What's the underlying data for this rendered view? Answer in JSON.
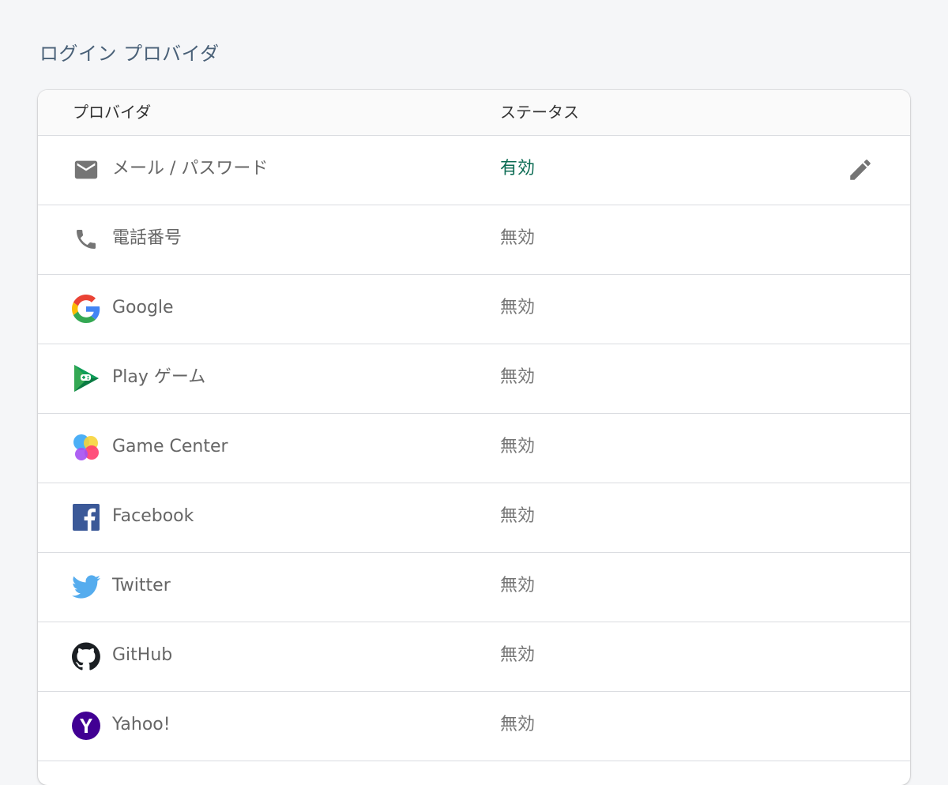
{
  "page": {
    "title": "ログイン プロバイダ"
  },
  "table": {
    "headers": {
      "provider": "プロバイダ",
      "status": "ステータス"
    },
    "rows": [
      {
        "name": "メール / パスワード",
        "status": "有効",
        "icon": "email-icon",
        "enabled": true
      },
      {
        "name": "電話番号",
        "status": "無効",
        "icon": "phone-icon",
        "enabled": false
      },
      {
        "name": "Google",
        "status": "無効",
        "icon": "google-icon",
        "enabled": false
      },
      {
        "name": "Play ゲーム",
        "status": "無効",
        "icon": "play-games-icon",
        "enabled": false
      },
      {
        "name": "Game Center",
        "status": "無効",
        "icon": "game-center-icon",
        "enabled": false
      },
      {
        "name": "Facebook",
        "status": "無効",
        "icon": "facebook-icon",
        "enabled": false
      },
      {
        "name": "Twitter",
        "status": "無効",
        "icon": "twitter-icon",
        "enabled": false
      },
      {
        "name": "GitHub",
        "status": "無効",
        "icon": "github-icon",
        "enabled": false
      },
      {
        "name": "Yahoo!",
        "status": "無効",
        "icon": "yahoo-icon",
        "enabled": false
      }
    ]
  },
  "colors": {
    "enabled_status": "#0b6b53",
    "disabled_status": "#757575",
    "title": "#4a6178"
  }
}
